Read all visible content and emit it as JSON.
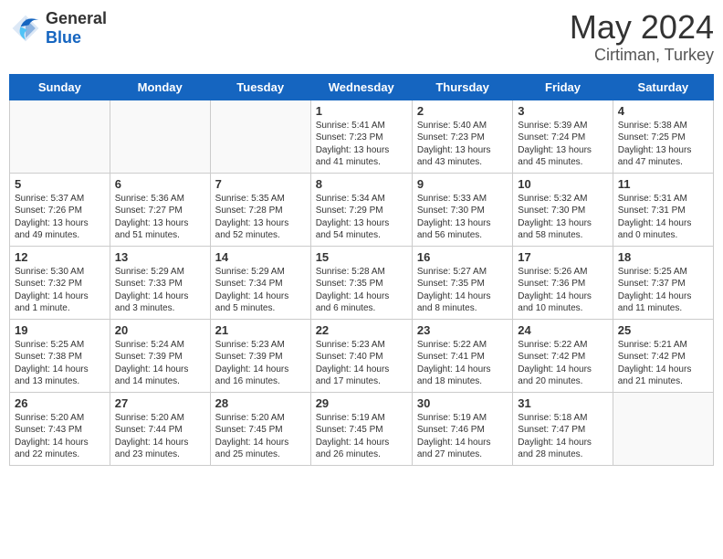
{
  "logo": {
    "general": "General",
    "blue": "Blue"
  },
  "title": {
    "month_year": "May 2024",
    "location": "Cirtiman, Turkey"
  },
  "headers": [
    "Sunday",
    "Monday",
    "Tuesday",
    "Wednesday",
    "Thursday",
    "Friday",
    "Saturday"
  ],
  "weeks": [
    [
      {
        "num": "",
        "detail": ""
      },
      {
        "num": "",
        "detail": ""
      },
      {
        "num": "",
        "detail": ""
      },
      {
        "num": "1",
        "detail": "Sunrise: 5:41 AM\nSunset: 7:23 PM\nDaylight: 13 hours\nand 41 minutes."
      },
      {
        "num": "2",
        "detail": "Sunrise: 5:40 AM\nSunset: 7:23 PM\nDaylight: 13 hours\nand 43 minutes."
      },
      {
        "num": "3",
        "detail": "Sunrise: 5:39 AM\nSunset: 7:24 PM\nDaylight: 13 hours\nand 45 minutes."
      },
      {
        "num": "4",
        "detail": "Sunrise: 5:38 AM\nSunset: 7:25 PM\nDaylight: 13 hours\nand 47 minutes."
      }
    ],
    [
      {
        "num": "5",
        "detail": "Sunrise: 5:37 AM\nSunset: 7:26 PM\nDaylight: 13 hours\nand 49 minutes."
      },
      {
        "num": "6",
        "detail": "Sunrise: 5:36 AM\nSunset: 7:27 PM\nDaylight: 13 hours\nand 51 minutes."
      },
      {
        "num": "7",
        "detail": "Sunrise: 5:35 AM\nSunset: 7:28 PM\nDaylight: 13 hours\nand 52 minutes."
      },
      {
        "num": "8",
        "detail": "Sunrise: 5:34 AM\nSunset: 7:29 PM\nDaylight: 13 hours\nand 54 minutes."
      },
      {
        "num": "9",
        "detail": "Sunrise: 5:33 AM\nSunset: 7:30 PM\nDaylight: 13 hours\nand 56 minutes."
      },
      {
        "num": "10",
        "detail": "Sunrise: 5:32 AM\nSunset: 7:30 PM\nDaylight: 13 hours\nand 58 minutes."
      },
      {
        "num": "11",
        "detail": "Sunrise: 5:31 AM\nSunset: 7:31 PM\nDaylight: 14 hours\nand 0 minutes."
      }
    ],
    [
      {
        "num": "12",
        "detail": "Sunrise: 5:30 AM\nSunset: 7:32 PM\nDaylight: 14 hours\nand 1 minute."
      },
      {
        "num": "13",
        "detail": "Sunrise: 5:29 AM\nSunset: 7:33 PM\nDaylight: 14 hours\nand 3 minutes."
      },
      {
        "num": "14",
        "detail": "Sunrise: 5:29 AM\nSunset: 7:34 PM\nDaylight: 14 hours\nand 5 minutes."
      },
      {
        "num": "15",
        "detail": "Sunrise: 5:28 AM\nSunset: 7:35 PM\nDaylight: 14 hours\nand 6 minutes."
      },
      {
        "num": "16",
        "detail": "Sunrise: 5:27 AM\nSunset: 7:35 PM\nDaylight: 14 hours\nand 8 minutes."
      },
      {
        "num": "17",
        "detail": "Sunrise: 5:26 AM\nSunset: 7:36 PM\nDaylight: 14 hours\nand 10 minutes."
      },
      {
        "num": "18",
        "detail": "Sunrise: 5:25 AM\nSunset: 7:37 PM\nDaylight: 14 hours\nand 11 minutes."
      }
    ],
    [
      {
        "num": "19",
        "detail": "Sunrise: 5:25 AM\nSunset: 7:38 PM\nDaylight: 14 hours\nand 13 minutes."
      },
      {
        "num": "20",
        "detail": "Sunrise: 5:24 AM\nSunset: 7:39 PM\nDaylight: 14 hours\nand 14 minutes."
      },
      {
        "num": "21",
        "detail": "Sunrise: 5:23 AM\nSunset: 7:39 PM\nDaylight: 14 hours\nand 16 minutes."
      },
      {
        "num": "22",
        "detail": "Sunrise: 5:23 AM\nSunset: 7:40 PM\nDaylight: 14 hours\nand 17 minutes."
      },
      {
        "num": "23",
        "detail": "Sunrise: 5:22 AM\nSunset: 7:41 PM\nDaylight: 14 hours\nand 18 minutes."
      },
      {
        "num": "24",
        "detail": "Sunrise: 5:22 AM\nSunset: 7:42 PM\nDaylight: 14 hours\nand 20 minutes."
      },
      {
        "num": "25",
        "detail": "Sunrise: 5:21 AM\nSunset: 7:42 PM\nDaylight: 14 hours\nand 21 minutes."
      }
    ],
    [
      {
        "num": "26",
        "detail": "Sunrise: 5:20 AM\nSunset: 7:43 PM\nDaylight: 14 hours\nand 22 minutes."
      },
      {
        "num": "27",
        "detail": "Sunrise: 5:20 AM\nSunset: 7:44 PM\nDaylight: 14 hours\nand 23 minutes."
      },
      {
        "num": "28",
        "detail": "Sunrise: 5:20 AM\nSunset: 7:45 PM\nDaylight: 14 hours\nand 25 minutes."
      },
      {
        "num": "29",
        "detail": "Sunrise: 5:19 AM\nSunset: 7:45 PM\nDaylight: 14 hours\nand 26 minutes."
      },
      {
        "num": "30",
        "detail": "Sunrise: 5:19 AM\nSunset: 7:46 PM\nDaylight: 14 hours\nand 27 minutes."
      },
      {
        "num": "31",
        "detail": "Sunrise: 5:18 AM\nSunset: 7:47 PM\nDaylight: 14 hours\nand 28 minutes."
      },
      {
        "num": "",
        "detail": ""
      }
    ]
  ]
}
